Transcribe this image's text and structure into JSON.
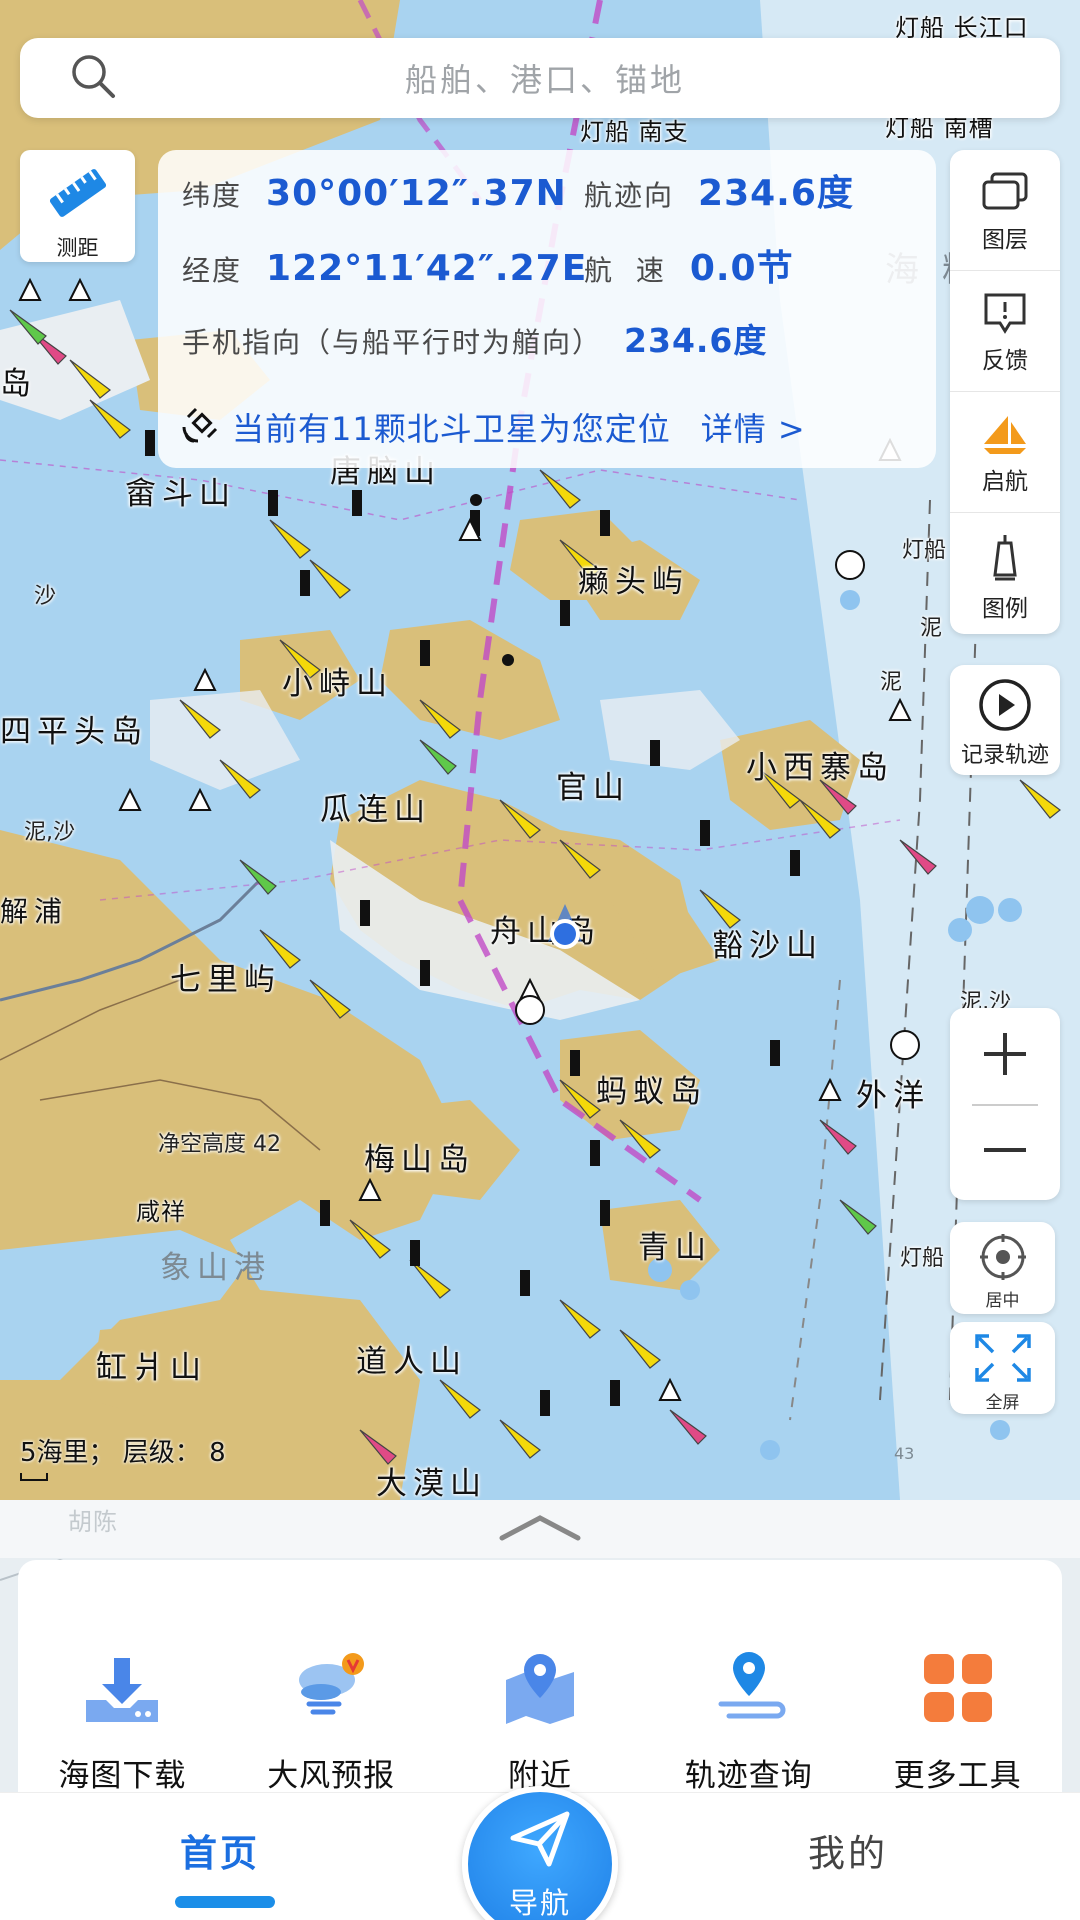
{
  "search": {
    "placeholder": "船舶、港口、锚地"
  },
  "ruler": {
    "label": "测距"
  },
  "info": {
    "lat_label": "纬度",
    "lat_value": "30°00′12″.37N",
    "course_label": "航迹向",
    "course_value": "234.6度",
    "lon_label": "经度",
    "lon_value": "122°11′42″.27E",
    "speed_label": "航  速",
    "speed_value": "0.0节",
    "heading_label": "手机指向（与船平行时为艏向）",
    "heading_value": "234.6度",
    "satellite_text": "当前有11颗北斗卫星为您定位",
    "details_link": "详情 >"
  },
  "right_toolbar": [
    {
      "label": "图层",
      "icon": "layers-icon"
    },
    {
      "label": "反馈",
      "icon": "feedback-icon"
    },
    {
      "label": "启航",
      "icon": "sail-icon"
    },
    {
      "label": "图例",
      "icon": "legend-icon"
    }
  ],
  "record_track": {
    "label": "记录轨迹"
  },
  "center_button": {
    "label": "居中"
  },
  "fullscreen_button": {
    "label": "全屏"
  },
  "scale": {
    "text": "5海里；  层级：  8"
  },
  "map_labels": {
    "l1": "灯船 长江口",
    "l2": "灯船 南支",
    "l3": "灯船 南槽",
    "l4": "海 粮",
    "l5": "岛",
    "l6": "唐脑山",
    "l7": "畲斗山",
    "l8": "沙",
    "l9": "癞头屿",
    "l10": "灯船",
    "l11": "泥",
    "l12": "泥",
    "l13": "小峙山",
    "l14": "四平头岛",
    "l15": "官山",
    "l16": "小西寨岛",
    "l17": "泥,沙",
    "l18": "瓜连山",
    "l19": "解浦",
    "l20": "舟山岛",
    "l21": "豁沙山",
    "l22": "七里屿",
    "l23": "泥,沙",
    "l24": "蚂蚁岛",
    "l25": "外洋",
    "l26": "净空高度 42",
    "l27": "梅山岛",
    "l28": "咸祥",
    "l29": "象山港",
    "l30": "青山",
    "l31": "灯船",
    "l32": "缸爿山",
    "l33": "道人山",
    "l34": "大漠山",
    "l35": "胡陈",
    "l36": "43"
  },
  "tools": [
    {
      "label": "海图下载",
      "icon": "download-icon"
    },
    {
      "label": "大风预报",
      "icon": "wind-forecast-icon"
    },
    {
      "label": "附近",
      "icon": "nearby-map-icon"
    },
    {
      "label": "轨迹查询",
      "icon": "track-query-icon"
    },
    {
      "label": "更多工具",
      "icon": "more-tools-icon"
    }
  ],
  "nav": {
    "home": "首页",
    "navigate": "导航",
    "mine": "我的"
  },
  "colors": {
    "accent": "#1b5ad1",
    "nav_active": "#1b6fe0",
    "land": "#d9bf7a",
    "sea": "#a9d3f0"
  }
}
